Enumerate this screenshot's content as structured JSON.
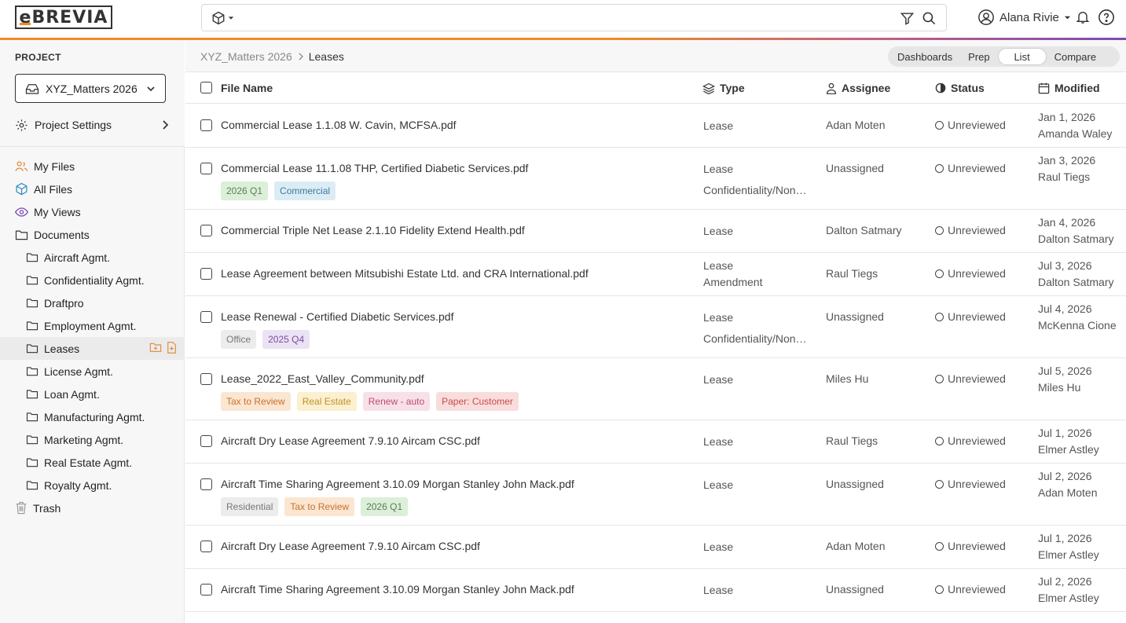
{
  "app": {
    "logo_text": "eBREVIA",
    "colors": {
      "accent": "#f08a24",
      "accent_end": "#7b4bb3"
    }
  },
  "search": {
    "placeholder": "",
    "scope_icon": "cube-icon"
  },
  "user": {
    "name": "Alana Rivie"
  },
  "sidebar": {
    "project_label": "PROJECT",
    "project_value": "XYZ_Matters 2026",
    "project_settings": "Project Settings",
    "nav": [
      {
        "label": "My Files",
        "icon": "users-icon"
      },
      {
        "label": "All Files",
        "icon": "cube-icon"
      },
      {
        "label": "My Views",
        "icon": "eye-icon"
      },
      {
        "label": "Documents",
        "icon": "folder-icon"
      }
    ],
    "folders": [
      "Aircraft Agmt.",
      "Confidentiality Agmt.",
      "Draftpro",
      "Employment Agmt.",
      "Leases",
      "License Agmt.",
      "Loan Agmt.",
      "Manufacturing Agmt.",
      "Marketing Agmt.",
      "Real Estate Agmt.",
      "Royalty Agmt."
    ],
    "active_folder": "Leases",
    "trash": "Trash"
  },
  "breadcrumb": {
    "root": "XYZ_Matters 2026",
    "current": "Leases"
  },
  "view_toggle": {
    "options": [
      "Dashboards",
      "Prep",
      "List",
      "Compare"
    ],
    "active": "List"
  },
  "table": {
    "headers": {
      "file_name": "File Name",
      "type": "Type",
      "assignee": "Assignee",
      "status": "Status",
      "modified": "Modified"
    },
    "rows": [
      {
        "name": "Commercial Lease 1.1.08 W. Cavin, MCFSA.pdf",
        "tags": [],
        "type": [
          "Lease"
        ],
        "assignee": "Adan Moten",
        "status": "Unreviewed",
        "date": "Jan 1, 2026",
        "by": "Amanda Waley"
      },
      {
        "name": "Commercial Lease 11.1.08 THP, Certified Diabetic Services.pdf",
        "tags": [
          {
            "t": "2026 Q1",
            "c": "green"
          },
          {
            "t": "Commercial",
            "c": "blue"
          }
        ],
        "type": [
          "Lease",
          "Confidentiality/Non…"
        ],
        "assignee": "Unassigned",
        "status": "Unreviewed",
        "date": "Jan 3, 2026",
        "by": "Raul Tiegs"
      },
      {
        "name": "Commercial Triple Net Lease 2.1.10 Fidelity Extend Health.pdf",
        "tags": [],
        "type": [
          "Lease"
        ],
        "assignee": "Dalton Satmary",
        "status": "Unreviewed",
        "date": "Jan 4, 2026",
        "by": "Dalton Satmary"
      },
      {
        "name": "Lease Agreement between Mitsubishi Estate Ltd. and CRA International.pdf",
        "tags": [],
        "type": [
          "Lease",
          "Amendment"
        ],
        "assignee": "Raul Tiegs",
        "status": "Unreviewed",
        "date": "Jul 3, 2026",
        "by": "Dalton Satmary"
      },
      {
        "name": "Lease Renewal - Certified Diabetic Services.pdf",
        "tags": [
          {
            "t": "Office",
            "c": "gray"
          },
          {
            "t": "2025 Q4",
            "c": "purple"
          }
        ],
        "type": [
          "Lease",
          "Confidentiality/Non…"
        ],
        "assignee": "Unassigned",
        "status": "Unreviewed",
        "date": "Jul 4, 2026",
        "by": "McKenna Cione"
      },
      {
        "name": "Lease_2022_East_Valley_Community.pdf",
        "tags": [
          {
            "t": "Tax to Review",
            "c": "orange"
          },
          {
            "t": "Real Estate",
            "c": "yellow"
          },
          {
            "t": "Renew - auto",
            "c": "pink"
          },
          {
            "t": "Paper: Customer",
            "c": "red"
          }
        ],
        "type": [
          "Lease"
        ],
        "assignee": "Miles Hu",
        "status": "Unreviewed",
        "date": "Jul 5, 2026",
        "by": "Miles Hu"
      },
      {
        "name": "Aircraft Dry Lease Agreement 7.9.10 Aircam CSC.pdf",
        "tags": [],
        "type": [
          "Lease"
        ],
        "assignee": "Raul Tiegs",
        "status": "Unreviewed",
        "date": "Jul 1, 2026",
        "by": "Elmer Astley"
      },
      {
        "name": "Aircraft Time Sharing Agreement 3.10.09 Morgan Stanley John Mack.pdf",
        "tags": [
          {
            "t": "Residential",
            "c": "gray"
          },
          {
            "t": "Tax to Review",
            "c": "orange"
          },
          {
            "t": "2026 Q1",
            "c": "green"
          }
        ],
        "type": [
          "Lease"
        ],
        "assignee": "Unassigned",
        "status": "Unreviewed",
        "date": "Jul 2, 2026",
        "by": "Adan Moten"
      },
      {
        "name": "Aircraft Dry Lease Agreement 7.9.10 Aircam CSC.pdf",
        "tags": [],
        "type": [
          "Lease"
        ],
        "assignee": "Adan Moten",
        "status": "Unreviewed",
        "date": "Jul 1, 2026",
        "by": "Elmer Astley"
      },
      {
        "name": "Aircraft Time Sharing Agreement 3.10.09 Morgan Stanley John Mack.pdf",
        "tags": [],
        "type": [
          "Lease"
        ],
        "assignee": "Unassigned",
        "status": "Unreviewed",
        "date": "Jul 2, 2026",
        "by": "Elmer Astley"
      }
    ]
  },
  "tag_colors": {
    "green": {
      "bg": "#dcefd9",
      "fg": "#5a7f52"
    },
    "blue": {
      "bg": "#dcecf5",
      "fg": "#3f7aa0"
    },
    "gray": {
      "bg": "#ececec",
      "fg": "#777777"
    },
    "purple": {
      "bg": "#ebe2f3",
      "fg": "#7a4e9e"
    },
    "orange": {
      "bg": "#fbe6d2",
      "fg": "#c7722d"
    },
    "yellow": {
      "bg": "#fbf0cf",
      "fg": "#c0902a"
    },
    "pink": {
      "bg": "#f8e0e8",
      "fg": "#b94d72"
    },
    "red": {
      "bg": "#f9dddd",
      "fg": "#c94a4a"
    }
  }
}
